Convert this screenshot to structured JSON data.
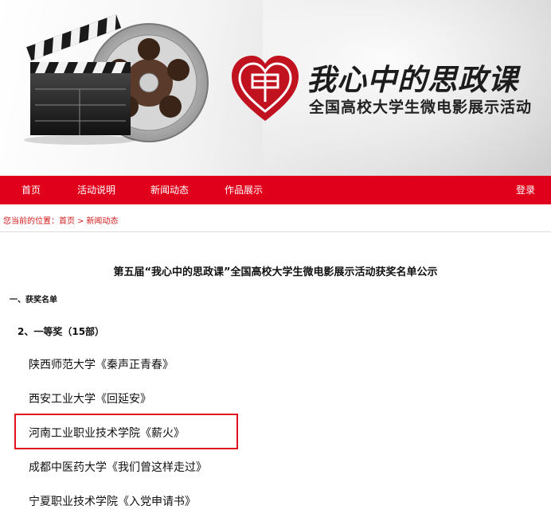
{
  "banner": {
    "title": "我心中的思政课",
    "subtitle": "全国高校大学生微电影展示活动",
    "logo_icon": "heart-logo-icon",
    "art_icon": "film-clapperboard-icon",
    "accent": "#e0001c"
  },
  "nav": {
    "items": [
      "首页",
      "活动说明",
      "新闻动态",
      "作品展示"
    ],
    "login": "登录"
  },
  "breadcrumb": {
    "prefix": "您当前的位置：",
    "home": "首页",
    "separator": ">",
    "current": "新闻动态"
  },
  "article": {
    "title": "第五届“我心中的思政课”全国高校大学生微电影展示活动获奖名单公示",
    "section": "一、获奖名单",
    "prize": "2、一等奖（15部）",
    "entries": [
      "陕西师范大学《秦声正青春》",
      "西安工业大学《回延安》",
      "河南工业职业技术学院《薪火》",
      "成都中医药大学《我们曾这样走过》",
      "宁夏职业技术学院《入党申请书》"
    ],
    "highlight_color": "#e1121e"
  }
}
